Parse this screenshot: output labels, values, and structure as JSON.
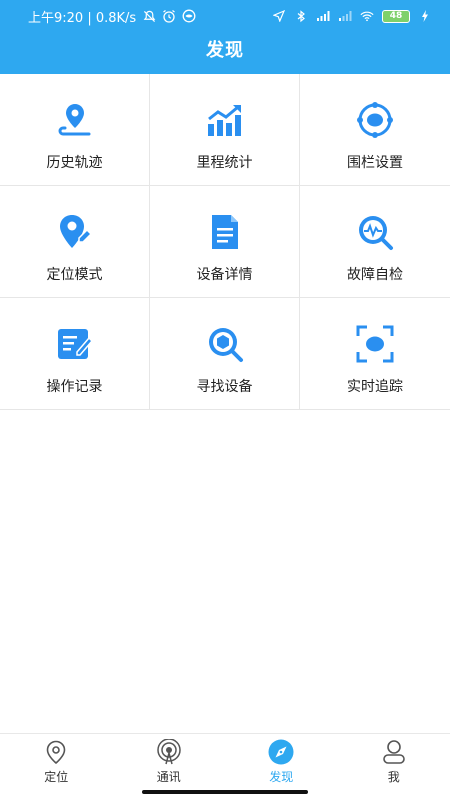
{
  "status_bar": {
    "left_text": "上午9:20 | 0.8K/s",
    "battery": "48"
  },
  "header": {
    "title": "发现"
  },
  "grid": {
    "items": [
      {
        "label": "历史轨迹",
        "icon": "route-pin-icon"
      },
      {
        "label": "里程统计",
        "icon": "bar-chart-trend-icon"
      },
      {
        "label": "围栏设置",
        "icon": "fence-target-icon"
      },
      {
        "label": "定位模式",
        "icon": "location-mode-icon"
      },
      {
        "label": "设备详情",
        "icon": "document-icon"
      },
      {
        "label": "故障自检",
        "icon": "diagnostic-magnifier-icon"
      },
      {
        "label": "操作记录",
        "icon": "edit-record-icon"
      },
      {
        "label": "寻找设备",
        "icon": "find-device-icon"
      },
      {
        "label": "实时追踪",
        "icon": "scan-frame-icon"
      }
    ]
  },
  "tabbar": {
    "items": [
      {
        "label": "定位",
        "icon": "location-pin-icon",
        "active": false
      },
      {
        "label": "通讯",
        "icon": "signal-tower-icon",
        "active": false
      },
      {
        "label": "发现",
        "icon": "compass-icon",
        "active": true
      },
      {
        "label": "我",
        "icon": "user-icon",
        "active": false
      }
    ]
  },
  "colors": {
    "primary": "#2ea8f0",
    "icon_blue": "#2a8ff0",
    "text": "#222222"
  }
}
